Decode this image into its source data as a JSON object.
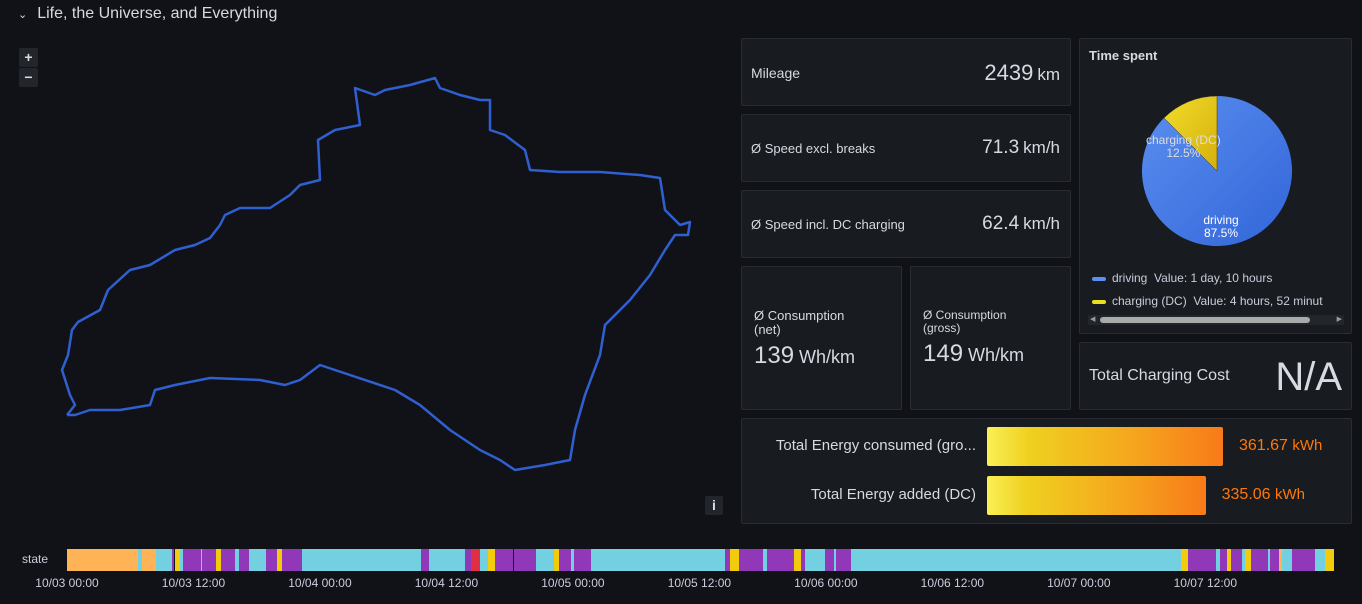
{
  "row": {
    "title": "Life, the Universe, and Everything"
  },
  "map": {
    "zoom_in": "+",
    "zoom_out": "−",
    "info": "i"
  },
  "stats": {
    "mileage": {
      "label": "Mileage",
      "value": "2439",
      "unit": "km"
    },
    "speed_excl": {
      "label": "Ø Speed excl. breaks",
      "value": "71.3",
      "unit": "km/h"
    },
    "speed_incl": {
      "label": "Ø Speed incl. DC charging",
      "value": "62.4",
      "unit": "km/h"
    },
    "cons_net": {
      "label": "Ø Consumption (net)",
      "value": "139",
      "unit": "Wh/km"
    },
    "cons_gross": {
      "label": "Ø Consumption (gross)",
      "value": "149",
      "unit": "Wh/km"
    },
    "charging_cost": {
      "label": "Total Charging Cost",
      "value": "N/A"
    }
  },
  "time_spent": {
    "title": "Time spent",
    "slices": [
      {
        "name": "driving",
        "percent": 87.5,
        "pct_label": "87.5%",
        "color": "#5b8ff0",
        "legend": "Value: 1 day, 10 hours"
      },
      {
        "name": "charging (DC)",
        "percent": 12.5,
        "pct_label": "12.5%",
        "color": "#e8c81a",
        "legend": "Value: 4 hours, 52 minut"
      }
    ]
  },
  "energy": {
    "items": [
      {
        "label": "Total Energy consumed (gro...",
        "value": 361.67,
        "display": "361.67",
        "unit": "kWh"
      },
      {
        "label": "Total Energy added (DC)",
        "value": 335.06,
        "display": "335.06",
        "unit": "kWh"
      }
    ]
  },
  "timeline": {
    "label": "state",
    "ticks": [
      "10/03 00:00",
      "10/03 12:00",
      "10/04 00:00",
      "10/04 12:00",
      "10/05 00:00",
      "10/05 12:00",
      "10/06 00:00",
      "10/06 12:00",
      "10/07 00:00",
      "10/07 12:00"
    ],
    "colors": {
      "o": "#ffb357",
      "c": "#73d0e0",
      "p": "#9138b8",
      "y": "#f2cc0c",
      "r": "#e02f44"
    },
    "segments": [
      [
        "o",
        0,
        6.7
      ],
      [
        "c",
        6.7,
        7.1
      ],
      [
        "o",
        7.1,
        8.4
      ],
      [
        "c",
        8.4,
        10.0
      ],
      [
        "p",
        10.0,
        10.2
      ],
      [
        "y",
        10.2,
        10.7
      ],
      [
        "c",
        10.7,
        11.0
      ],
      [
        "p",
        11.0,
        12.7
      ],
      [
        "c",
        12.7,
        12.8
      ],
      [
        "p",
        12.8,
        14.1
      ],
      [
        "y",
        14.1,
        14.6
      ],
      [
        "p",
        14.6,
        15.9
      ],
      [
        "c",
        15.9,
        16.3
      ],
      [
        "p",
        16.3,
        17.3
      ],
      [
        "c",
        17.3,
        18.9
      ],
      [
        "p",
        18.9,
        19.9
      ],
      [
        "y",
        19.9,
        20.4
      ],
      [
        "p",
        20.4,
        22.3
      ],
      [
        "c",
        22.3,
        33.6
      ],
      [
        "p",
        33.6,
        34.3
      ],
      [
        "c",
        34.3,
        37.8
      ],
      [
        "p",
        37.8,
        38.3
      ],
      [
        "r",
        38.3,
        39.2
      ],
      [
        "c",
        39.2,
        39.9
      ],
      [
        "y",
        39.9,
        40.6
      ],
      [
        "p",
        40.6,
        42.3
      ],
      [
        "p",
        42.4,
        44.5
      ],
      [
        "c",
        44.5,
        46.2
      ],
      [
        "y",
        46.2,
        46.7
      ],
      [
        "p",
        46.7,
        47.8
      ],
      [
        "c",
        47.8,
        48.1
      ],
      [
        "p",
        48.1,
        49.7
      ],
      [
        "c",
        49.7,
        62.4
      ],
      [
        "p",
        62.4,
        62.9
      ],
      [
        "y",
        62.9,
        63.8
      ],
      [
        "p",
        63.8,
        66.0
      ],
      [
        "c",
        66.0,
        66.4
      ],
      [
        "p",
        66.4,
        69.0
      ],
      [
        "y",
        69.0,
        69.6
      ],
      [
        "p",
        69.6,
        70.0
      ],
      [
        "c",
        70.0,
        71.9
      ],
      [
        "p",
        71.9,
        72.8
      ],
      [
        "c",
        72.8,
        73.0
      ],
      [
        "p",
        73.0,
        74.4
      ],
      [
        "c",
        74.4,
        105.7
      ],
      [
        "y",
        105.7,
        106.4
      ],
      [
        "p",
        106.4,
        109.0
      ],
      [
        "c",
        109.0,
        109.4
      ],
      [
        "p",
        109.4,
        110.1
      ],
      [
        "y",
        110.1,
        110.4
      ],
      [
        "p",
        110.4,
        111.5
      ],
      [
        "c",
        111.5,
        111.8
      ],
      [
        "y",
        111.8,
        112.3
      ],
      [
        "p",
        112.3,
        113.9
      ],
      [
        "c",
        113.9,
        114.1
      ],
      [
        "p",
        114.1,
        115.0
      ],
      [
        "o",
        115.0,
        115.3
      ],
      [
        "c",
        115.3,
        116.2
      ],
      [
        "p",
        116.2,
        118.4
      ],
      [
        "c",
        118.4,
        119.4
      ],
      [
        "y",
        119.4,
        120.2
      ]
    ]
  }
}
